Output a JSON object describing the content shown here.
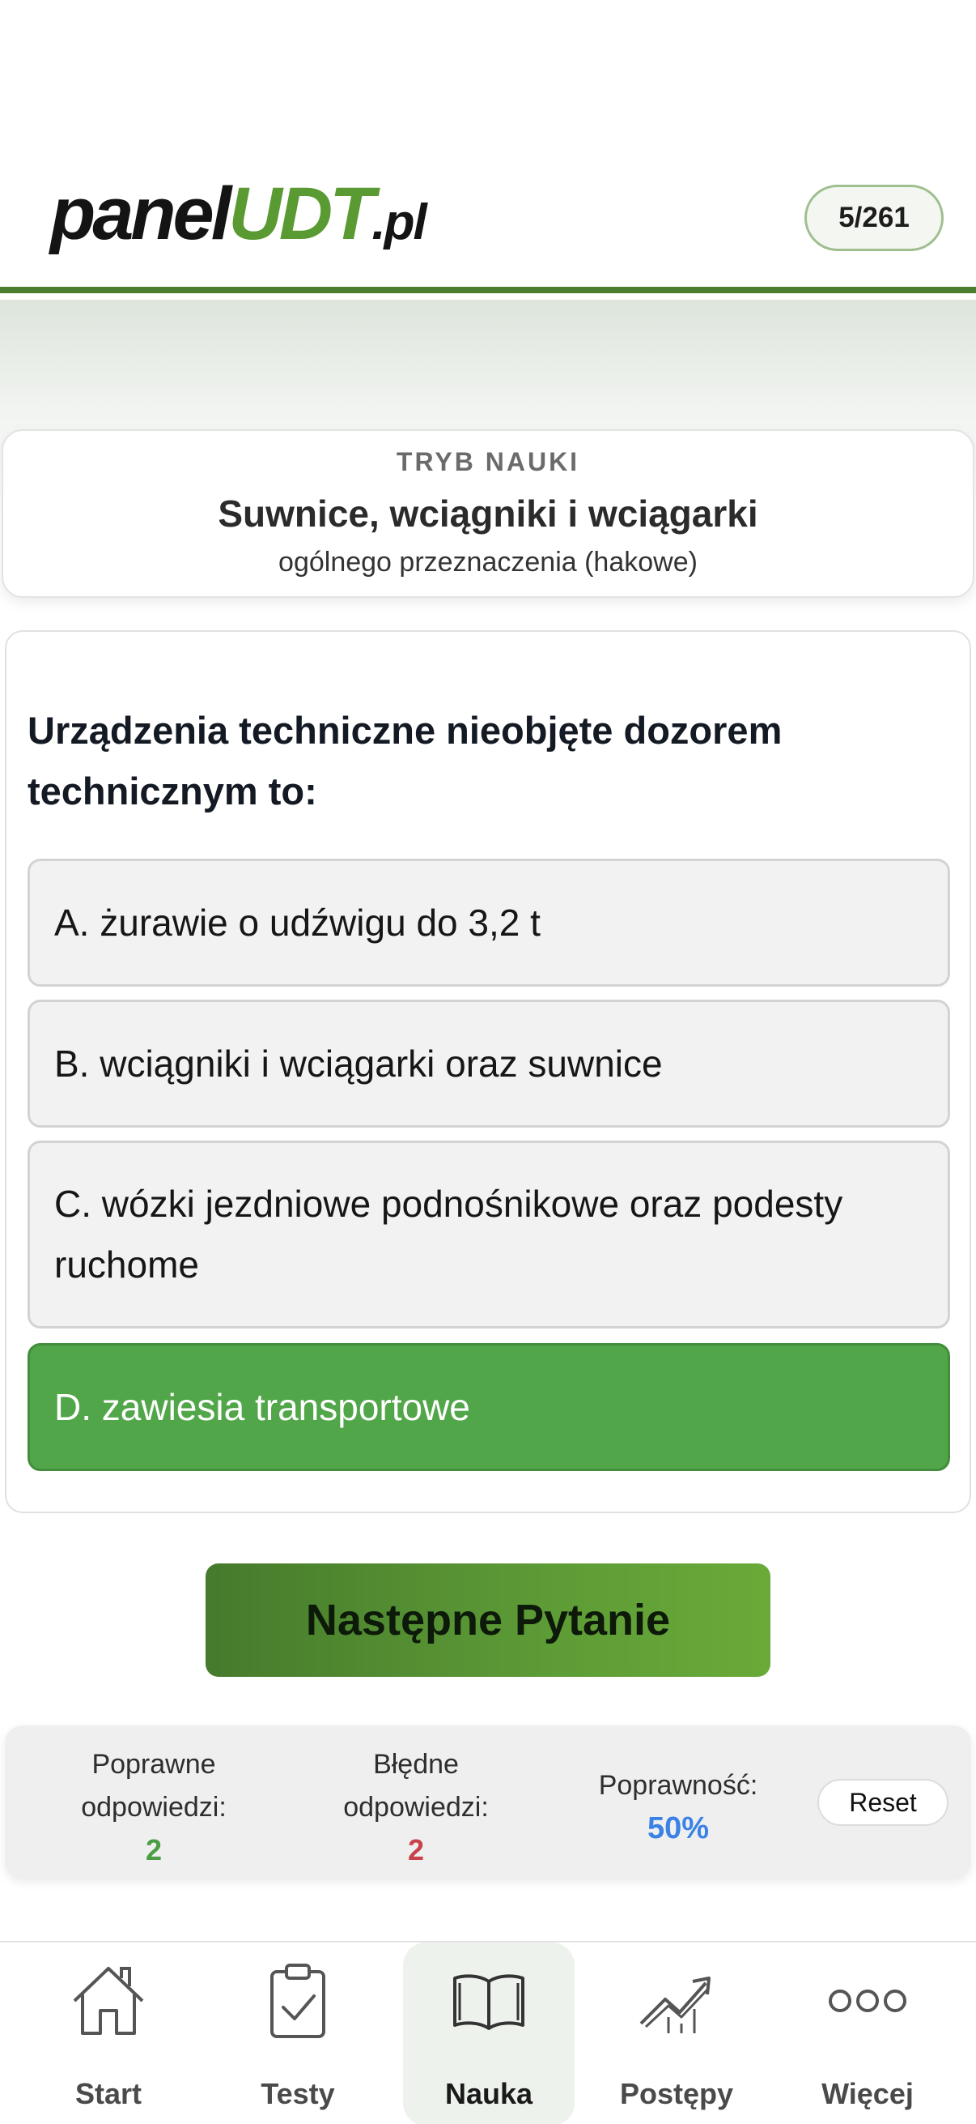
{
  "header": {
    "logo_part1": "panel",
    "logo_part2": "UDT",
    "logo_part3": ".pl",
    "counter": "5/261"
  },
  "mode": {
    "label": "TRYB NAUKI",
    "title": "Suwnice, wciągniki i wciągarki",
    "subtitle": "ogólnego przeznaczenia (hakowe)"
  },
  "question": {
    "text": "Urządzenia techniczne nieobjęte dozorem technicznym to:",
    "answers": [
      {
        "label": "A. żurawie o udźwigu do 3,2 t",
        "correct": false
      },
      {
        "label": "B. wciągniki i wciągarki oraz suwnice",
        "correct": false
      },
      {
        "label": "C. wózki jezdniowe podnośnikowe oraz podesty ruchome",
        "correct": false
      },
      {
        "label": "D. zawiesia transportowe",
        "correct": true
      }
    ]
  },
  "next_button": "Następne Pytanie",
  "stats": {
    "correct_label": "Poprawne odpowiedzi:",
    "correct_value": "2",
    "wrong_label": "Błędne odpowiedzi:",
    "wrong_value": "2",
    "accuracy_label": "Poprawność:",
    "accuracy_value": "50%",
    "reset_label": "Reset"
  },
  "tabs": [
    {
      "label": "Start",
      "icon": "house-icon"
    },
    {
      "label": "Testy",
      "icon": "clipboard-check-icon"
    },
    {
      "label": "Nauka",
      "icon": "open-book-icon",
      "active": true
    },
    {
      "label": "Postępy",
      "icon": "trend-up-icon"
    },
    {
      "label": "Więcej",
      "icon": "more-dots-icon"
    }
  ],
  "colors": {
    "brand_green": "#5a9a32",
    "correct_answer": "#52a64a",
    "wrong_value": "#c9424a",
    "accuracy_value": "#3b82e6"
  }
}
